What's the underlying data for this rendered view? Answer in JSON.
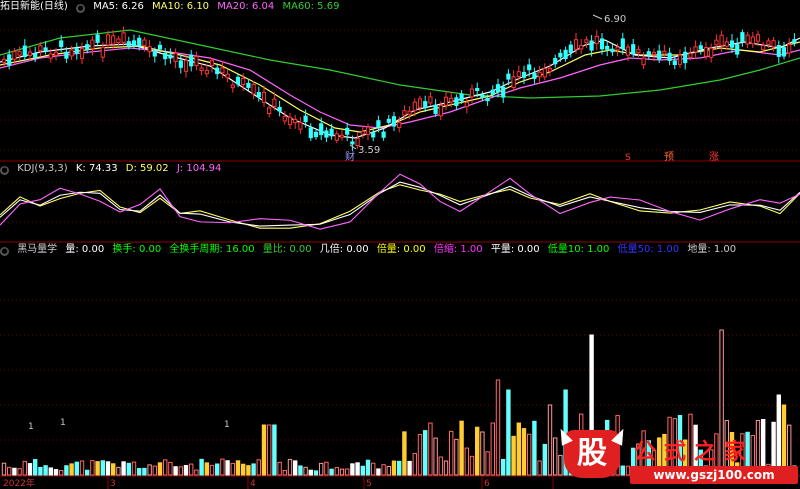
{
  "stock": {
    "name": "拓日新能(日线)",
    "ma": [
      {
        "label": "MA5: 6.26",
        "color": "#ffffff"
      },
      {
        "label": "MA10: 6.10",
        "color": "#ffff66"
      },
      {
        "label": "MA20: 6.04",
        "color": "#ff66ff"
      },
      {
        "label": "MA60: 5.69",
        "color": "#33cc33"
      }
    ],
    "high_label": "6.90",
    "low_label": "3.59",
    "markers": [
      {
        "text": "财",
        "color": "#9999ff"
      },
      {
        "text": "S",
        "color": "#ff3333"
      },
      {
        "text": "预",
        "color": "#ff6633"
      },
      {
        "text": "涨",
        "color": "#ff3333"
      }
    ]
  },
  "kdj": {
    "name": "KDJ(9,3,3)",
    "values": [
      {
        "label": "K: 74.33",
        "color": "#ffffff"
      },
      {
        "label": "D: 59.02",
        "color": "#ffff66"
      },
      {
        "label": "J: 104.94",
        "color": "#ff66ff"
      }
    ]
  },
  "volume": {
    "name": "黑马量学",
    "values": [
      {
        "label": "量: 0.00",
        "color": "#ffffff"
      },
      {
        "label": "换手: 0.00",
        "color": "#00ff00"
      },
      {
        "label": "全换手周期: 16.00",
        "color": "#00ff00"
      },
      {
        "label": "量比: 0.00",
        "color": "#33cc33"
      },
      {
        "label": "几倍: 0.00",
        "color": "#ffffff"
      },
      {
        "label": "倍量: 0.00",
        "color": "#ffff00"
      },
      {
        "label": "倍缩: 1.00",
        "color": "#ff33ff"
      },
      {
        "label": "平量: 0.00",
        "color": "#ffffff"
      },
      {
        "label": "低量10: 1.00",
        "color": "#00ff00"
      },
      {
        "label": "低量50: 1.00",
        "color": "#3333ff"
      },
      {
        "label": "地量: 1.00",
        "color": "#cccccc"
      }
    ],
    "small_labels": [
      "1",
      "1",
      "1"
    ]
  },
  "xaxis": {
    "labels": [
      "2022年",
      "3",
      "4",
      "5",
      "6"
    ]
  },
  "watermark": {
    "badge": "股",
    "title": "公式之家",
    "url": "www.gszj100.com"
  }
}
